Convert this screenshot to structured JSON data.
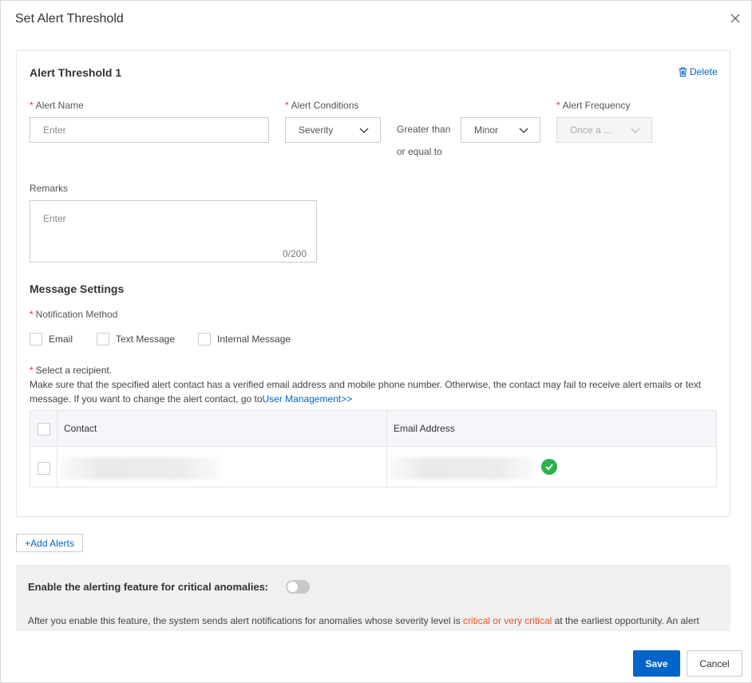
{
  "dialog": {
    "title": "Set Alert Threshold",
    "close_icon": "close-icon"
  },
  "threshold": {
    "title": "Alert Threshold 1",
    "delete_label": "Delete",
    "delete_icon": "trash-icon",
    "alert_name": {
      "label": "Alert Name",
      "placeholder": "Enter",
      "required": "*"
    },
    "alert_conditions": {
      "label": "Alert Conditions",
      "required": "*",
      "metric_value": "Severity",
      "operator_line1": "Greater than",
      "operator_line2": "or equal to",
      "level_value": "Minor"
    },
    "alert_frequency": {
      "label": "Alert Frequency",
      "required": "*",
      "value": "Once a ..."
    },
    "remarks": {
      "label": "Remarks",
      "placeholder": "Enter",
      "counter": "0/200"
    }
  },
  "message_settings": {
    "title": "Message Settings",
    "notification_method_label": "Notification Method",
    "methods": [
      "Email",
      "Text Message",
      "Internal Message"
    ],
    "recipient_label": "Select a recipient.",
    "note_text": "Make sure that the specified alert contact has a verified email address and mobile phone number. Otherwise, the contact may fail to receive alert emails or text message. If you want to change the alert contact, go to",
    "note_link": "User Management>>",
    "table": {
      "columns": [
        "Contact",
        "Email Address"
      ],
      "rows": [
        {
          "contact": "",
          "email": "",
          "verified_icon": "check-circle-icon"
        }
      ]
    }
  },
  "add_alerts_label": "+Add Alerts",
  "critical_panel": {
    "title": "Enable the alerting feature for critical anomalies:",
    "toggle_state": "off",
    "text_before": "After you enable this feature, the system sends alert notifications for anomalies whose severity level is ",
    "text_highlight": "critical or very critical",
    "text_after": " at the earliest opportunity. An alert"
  },
  "footer": {
    "save_label": "Save",
    "cancel_label": "Cancel"
  },
  "colors": {
    "primary": "#0064c8",
    "required": "#f5222d",
    "success": "#2bb24c",
    "highlight": "#e8552d"
  }
}
